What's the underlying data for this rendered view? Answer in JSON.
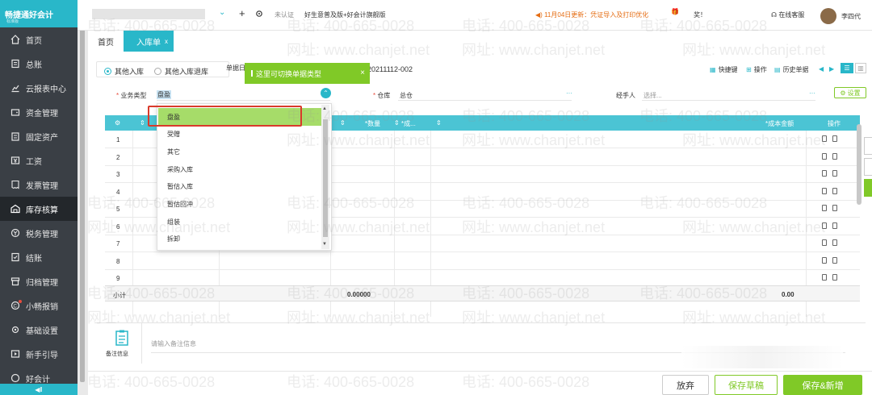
{
  "app": {
    "logo": "畅捷通好会计",
    "logo_sub": "标准版"
  },
  "sidebar": {
    "items": [
      {
        "label": "首页",
        "icon": "home-icon"
      },
      {
        "label": "总账",
        "icon": "ledger-icon"
      },
      {
        "label": "云报表中心",
        "icon": "chart-icon"
      },
      {
        "label": "资金管理",
        "icon": "wallet-icon"
      },
      {
        "label": "固定资产",
        "icon": "building-icon"
      },
      {
        "label": "工资",
        "icon": "payroll-icon"
      },
      {
        "label": "发票管理",
        "icon": "invoice-icon"
      },
      {
        "label": "库存核算",
        "icon": "warehouse-icon"
      },
      {
        "label": "税务管理",
        "icon": "tax-icon"
      },
      {
        "label": "结账",
        "icon": "checkout-icon"
      },
      {
        "label": "归档管理",
        "icon": "archive-icon"
      },
      {
        "label": "小畅报销",
        "icon": "reimburse-icon"
      },
      {
        "label": "基础设置",
        "icon": "settings-icon"
      },
      {
        "label": "新手引导",
        "icon": "guide-icon"
      },
      {
        "label": "好会计",
        "icon": "brand-icon"
      }
    ],
    "active_index": 7,
    "collapse_label": "◀‖"
  },
  "topbar": {
    "plus": "+",
    "cert": "未认证",
    "product": "好生意普及版+好会计旗舰版",
    "notice": "11月04日更新：凭证导入及打印优化",
    "gift_label": "奖！",
    "service": "在线客服",
    "user": "李四代"
  },
  "tabs": [
    {
      "label": "首页"
    },
    {
      "label": "入库单",
      "close": "x"
    }
  ],
  "form": {
    "radio_other_in": "其他入库",
    "radio_other_return": "其他入库退库",
    "doc_no_label": "单据日",
    "doc_no": "20211112-002",
    "tooltip": "这里可切换单据类型",
    "tooltip_close": "×",
    "tools": [
      "快捷键",
      "操作",
      "历史单据"
    ],
    "biz_type_label": "业务类型",
    "biz_type_value": "盘盈",
    "warehouse_label": "仓库",
    "warehouse_value": "总仓",
    "handler_label": "经手人",
    "handler_placeholder": "选择...",
    "dots": "···",
    "settings": "设置"
  },
  "grid": {
    "headers": {
      "qty": "数量",
      "cost": "成...",
      "amount": "成本金额",
      "ops": "操作"
    },
    "rows": [
      "1",
      "2",
      "3",
      "4",
      "5",
      "6",
      "7",
      "8",
      "9"
    ],
    "subtotal_label": "小计",
    "subtotal_qty": "0.00000",
    "subtotal_amount": "0.00"
  },
  "dropdown": {
    "options": [
      "盘盈",
      "受赠",
      "其它",
      "采购入库",
      "暂估入库",
      "暂估回冲",
      "组装",
      "拆卸"
    ]
  },
  "note": {
    "label": "备注信息",
    "placeholder": "请输入备注信息"
  },
  "footer": {
    "abandon": "放弃",
    "draft": "保存草稿",
    "save_new": "保存&新增"
  },
  "watermark": {
    "phone": "电话: 400-665-0028",
    "site": "网址: www.chanjet.net"
  },
  "colors": {
    "brand": "#29b7c9",
    "green": "#80c927",
    "sidebar": "#3a3f45",
    "highlight": "#a6dc69",
    "red_box": "#d93a2b"
  }
}
